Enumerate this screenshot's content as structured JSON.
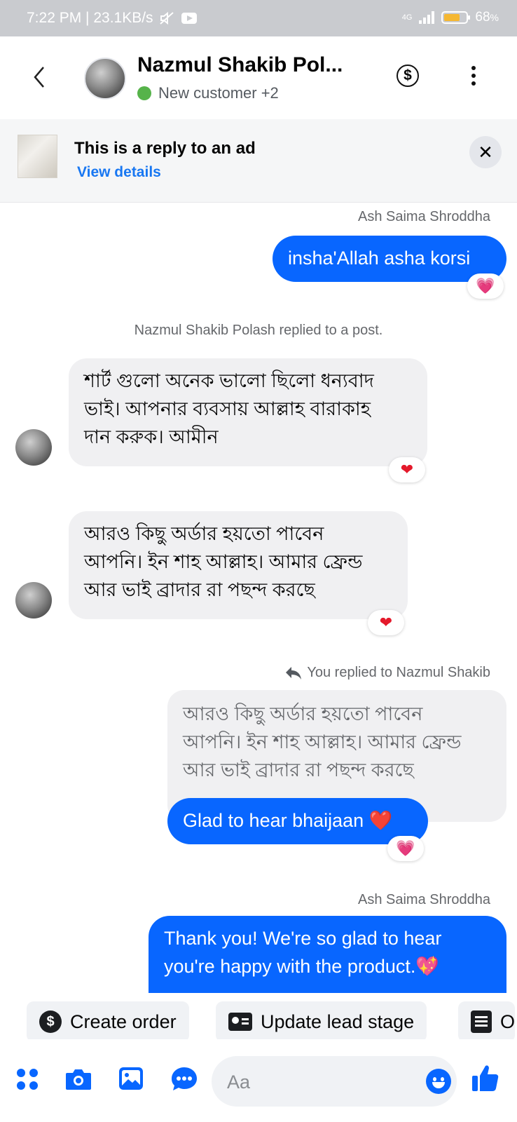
{
  "status_bar": {
    "time_speed": "7:22 PM | 23.1KB/s",
    "network": "4G",
    "battery": "68",
    "battery_unit": "%"
  },
  "header": {
    "title": "Nazmul Shakib Pol...",
    "subtitle": "New customer +2",
    "icons": [
      "back-arrow-icon",
      "dollar-icon",
      "more-options-icon"
    ]
  },
  "ad_banner": {
    "title": "This is a reply to an ad",
    "link": "View details",
    "close": "✕"
  },
  "messages": {
    "m1": {
      "sender": "Ash Saima Shroddha",
      "text": "insha'Allah asha korsi",
      "reaction": "💗"
    },
    "note": "Nazmul Shakib Polash replied to a post.",
    "m2": {
      "lines": [
        "শার্ট গুলো অনেক ভালো ছিলো ধন্যবাদ",
        "ভাই।  আপনার ব্যবসায় আল্লাহ বারাকাহ",
        "দান করুক। আমীন"
      ],
      "reaction": "❤"
    },
    "m3": {
      "lines": [
        "আরও কিছু অর্ডার হয়তো পাবেন",
        "আপনি। ইন শাহ আল্লাহ। আমার ফ্রেন্ড",
        "আর ভাই ব্রাদার রা পছন্দ করছে"
      ],
      "reaction": "❤"
    },
    "reply_note": "You replied to Nazmul Shakib",
    "quoted": {
      "lines": [
        "আরও কিছু অর্ডার হয়তো পাবেন",
        "আপনি। ইন শাহ আল্লাহ। আমার ফ্রেন্ড",
        "আর ভাই ব্রাদার রা পছন্দ করছে"
      ]
    },
    "m4": {
      "text": "Glad to hear bhaijaan ❤️",
      "reaction": "💗"
    },
    "m5": {
      "sender": "Ash Saima Shroddha",
      "lines": [
        "Thank you! We're so glad to hear",
        "you're happy with the product.💖"
      ]
    }
  },
  "quick_actions": {
    "create_order": "Create order",
    "update_lead": "Update lead stage",
    "third": "O"
  },
  "composer": {
    "placeholder": "Aa",
    "icons": [
      "menu-grid-icon",
      "camera-icon",
      "gallery-icon",
      "chat-bubble-icon",
      "emoji-icon",
      "thumbs-up-icon"
    ]
  },
  "colors": {
    "accent": "#0866ff",
    "incoming_bubble": "#f0f0f2",
    "online": "#56b34a"
  }
}
